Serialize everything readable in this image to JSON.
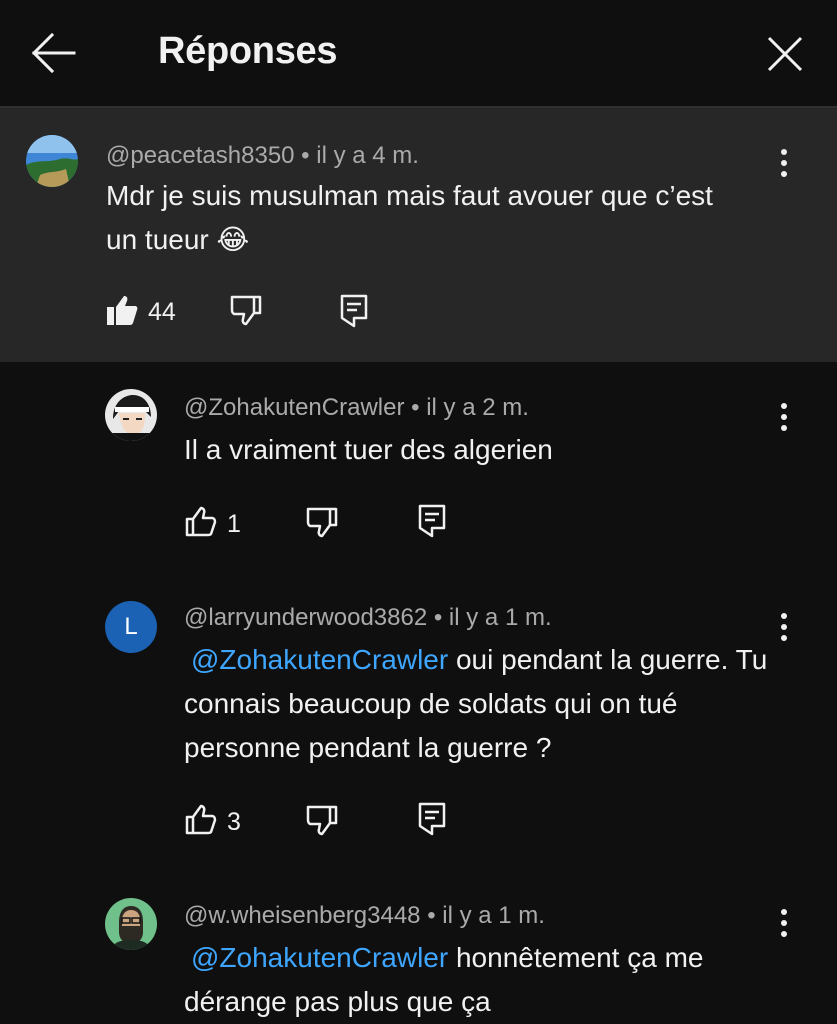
{
  "header": {
    "title": "Réponses",
    "back_icon": "arrow-left-icon",
    "close_icon": "close-icon"
  },
  "colors": {
    "background": "#0f0f0f",
    "highlight": "#272727",
    "mention": "#3ea6ff",
    "muted": "#aaaaaa"
  },
  "comments": [
    {
      "author": "@peacetash8350",
      "time": " • il y a 4 m.",
      "text": "Mdr je suis musulman mais faut avouer que c’est un tueur 😂",
      "likes": "44",
      "liked": true
    },
    {
      "author": "@ZohakutenCrawler",
      "time": " • il y a 2 m.",
      "text": "Il a vraiment tuer des algerien",
      "likes": "1",
      "liked": false
    },
    {
      "author": "@larryunderwood3862",
      "time": " • il y a 1 m.",
      "avatar_letter": "L",
      "mention": "@ZohakutenCrawler",
      "text": " oui pendant la guerre. Tu connais beaucoup de soldats qui on tué personne pendant la guerre ?",
      "likes": "3",
      "liked": false
    },
    {
      "author": "@w.wheisenberg3448",
      "time": " • il y a 1 m.",
      "mention": "@ZohakutenCrawler",
      "text": " honnêtement ça me dérange pas plus que ça"
    }
  ]
}
